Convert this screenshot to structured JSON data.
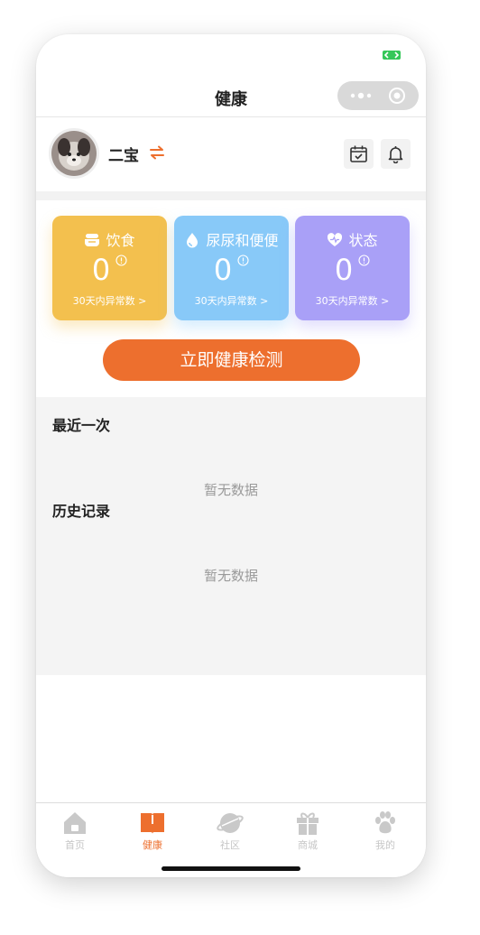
{
  "nav": {
    "title": "健康"
  },
  "pet": {
    "name": "二宝"
  },
  "cards": [
    {
      "title": "饮食",
      "value": "0",
      "footer": "30天内异常数 >",
      "color": "#f3c04e"
    },
    {
      "title": "尿尿和便便",
      "value": "0",
      "footer": "30天内异常数 >",
      "color": "#88c9f8"
    },
    {
      "title": "状态",
      "value": "0",
      "footer": "30天内异常数 >",
      "color": "#a9a0f7"
    }
  ],
  "cta": {
    "label": "立即健康检测",
    "color": "#ed6f2e"
  },
  "sections": {
    "recent": {
      "title": "最近一次",
      "empty": "暂无数据"
    },
    "history": {
      "title": "历史记录",
      "empty": "暂无数据"
    }
  },
  "tabs": [
    {
      "label": "首页",
      "icon": "home-icon",
      "active": false
    },
    {
      "label": "健康",
      "icon": "book-icon",
      "active": true
    },
    {
      "label": "社区",
      "icon": "planet-icon",
      "active": false
    },
    {
      "label": "商城",
      "icon": "gift-icon",
      "active": false
    },
    {
      "label": "我的",
      "icon": "paw-icon",
      "active": false
    }
  ]
}
